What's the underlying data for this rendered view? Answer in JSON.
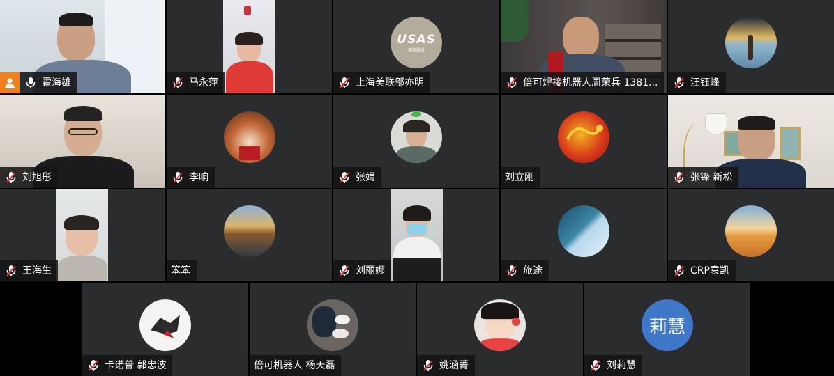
{
  "participants": [
    {
      "name": "霍海雄",
      "muted": false,
      "host": true
    },
    {
      "name": "马永萍",
      "muted": true
    },
    {
      "name": "上海美联邬亦明",
      "muted": true,
      "avatar_text": "USAS",
      "avatar_subtext": "美联股份"
    },
    {
      "name": "倍可焊接机器人周荣兵 1381...",
      "muted": true
    },
    {
      "name": "汪钰峰",
      "muted": true
    },
    {
      "name": "刘旭彤",
      "muted": true
    },
    {
      "name": "李响",
      "muted": true
    },
    {
      "name": "张娟",
      "muted": true
    },
    {
      "name": "刘立刚",
      "muted": false
    },
    {
      "name": "张锋 新松",
      "muted": true
    },
    {
      "name": "王海生",
      "muted": true
    },
    {
      "name": "笨笨",
      "muted": false
    },
    {
      "name": "刘丽娜",
      "muted": true
    },
    {
      "name": "旅途",
      "muted": true
    },
    {
      "name": "CRP袁凯",
      "muted": true
    },
    {
      "name": "卡诺普 郭忠波",
      "muted": true
    },
    {
      "name": "倍可机器人 杨天磊",
      "muted": false
    },
    {
      "name": "姚涵菁",
      "muted": true
    },
    {
      "name": "刘莉慧",
      "muted": true,
      "avatar_text": "莉慧"
    }
  ],
  "colors": {
    "tile_bg": "#2b2c2e",
    "label_bg": "#141416",
    "host_badge": "#f07f1c",
    "muted_red": "#e0383e",
    "text_avatar": "#3f78c9"
  }
}
